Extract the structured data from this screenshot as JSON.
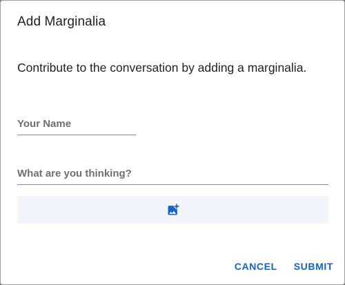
{
  "dialog": {
    "title": "Add Marginalia",
    "description": "Contribute to the conversation by adding a marginalia."
  },
  "form": {
    "name_label": "Your Name",
    "thought_label": "What are you thinking?",
    "image_icon": "add-photo-icon"
  },
  "actions": {
    "cancel_label": "CANCEL",
    "submit_label": "SUBMIT"
  },
  "colors": {
    "accent": "#1565c0",
    "image_area_bg": "#f2f6fb"
  }
}
